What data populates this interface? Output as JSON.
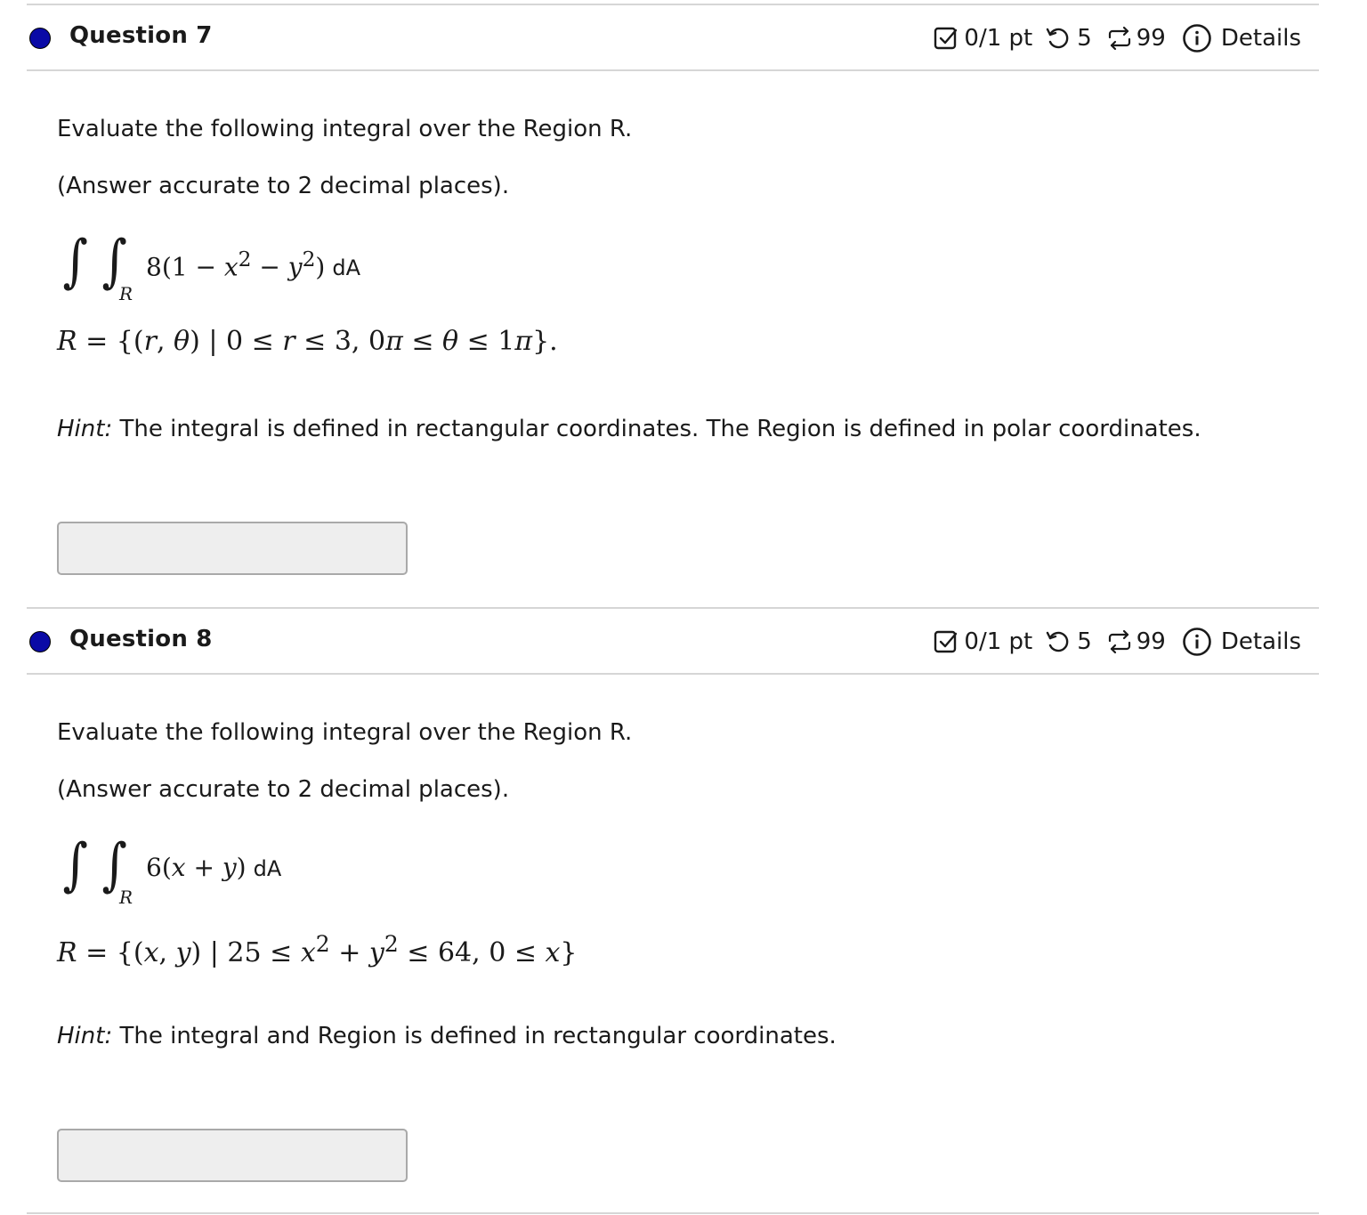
{
  "questions": [
    {
      "title": "Question 7",
      "score": "0/1 pt",
      "attempts": "5",
      "tries": "99",
      "details": "Details",
      "prompt": "Evaluate the following integral over the Region R.",
      "accuracy": "(Answer accurate to 2 decimal places).",
      "integral_sub": "R",
      "integrand_coef": "8",
      "integrand_open": "(1 − ",
      "var1": "x",
      "exp1": "2",
      "minus": " − ",
      "var2": "y",
      "exp2": "2",
      "integrand_close": ")",
      "da": "dA",
      "region_R": "R",
      "region_eq": " = {(",
      "region_r": "r",
      "region_comma": ", ",
      "region_theta": "θ",
      "region_mid": ") | 0 ≤ ",
      "region_r2": "r",
      "region_mid2": " ≤ 3, 0",
      "region_pi": "π",
      "region_mid3": " ≤ ",
      "region_theta2": "θ",
      "region_mid4": " ≤ 1",
      "region_pi2": "π",
      "region_end": "}.",
      "hint_label": "Hint:",
      "hint_text": " The integral is defined in rectangular coordinates. The Region is defined in polar coordinates.",
      "answer_value": ""
    },
    {
      "title": "Question 8",
      "score": "0/1 pt",
      "attempts": "5",
      "tries": "99",
      "details": "Details",
      "prompt": "Evaluate the following integral over the Region R.",
      "accuracy": "(Answer accurate to 2 decimal places).",
      "integral_sub": "R",
      "integrand_coef": "6(",
      "var1": "x",
      "plus": " + ",
      "var2": "y",
      "integrand_close": ")",
      "da": "dA",
      "region_R": "R",
      "region_eq": " = {(",
      "region_x": "x",
      "region_comma": ", ",
      "region_y": "y",
      "region_mid": ") | 25 ≤ ",
      "region_x2": "x",
      "region_exp1": "2",
      "region_plus": " + ",
      "region_y2": "y",
      "region_exp2": "2",
      "region_mid2": " ≤ 64, 0 ≤ ",
      "region_x3": "x",
      "region_end": "}",
      "hint_label": "Hint:",
      "hint_text": " The integral and Region is defined in rectangular coordinates.",
      "answer_value": ""
    }
  ]
}
